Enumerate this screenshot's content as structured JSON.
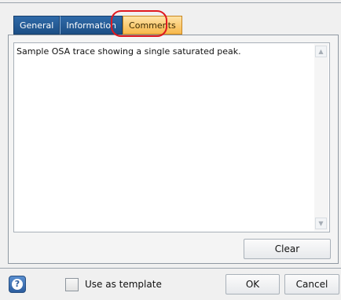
{
  "tabs": [
    {
      "label": "General"
    },
    {
      "label": "Information"
    },
    {
      "label": "Comments"
    }
  ],
  "comments": {
    "text": "Sample OSA trace showing a single saturated peak."
  },
  "buttons": {
    "clear": "Clear",
    "ok": "OK",
    "cancel": "Cancel"
  },
  "footer": {
    "help_symbol": "?",
    "template_label": "Use as template"
  },
  "colors": {
    "tab_active": "#f7b84b",
    "tab_inactive": "#1d4f86",
    "highlight_ring": "#e0181f"
  },
  "icons": {
    "scroll_up": "chevron-up-icon",
    "scroll_down": "chevron-down-icon",
    "help": "help-icon"
  }
}
